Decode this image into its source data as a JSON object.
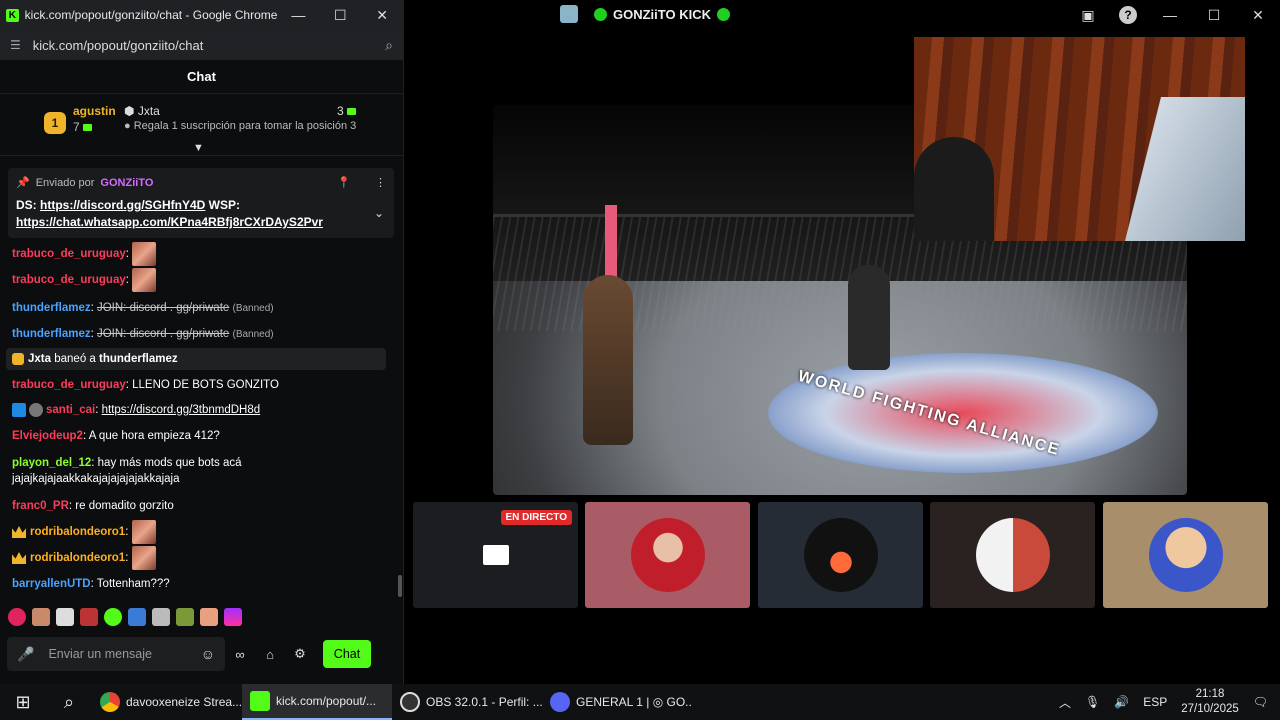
{
  "chrome": {
    "title": "kick.com/popout/gonziito/chat - Google Chrome",
    "url": "kick.com/popout/gonziito/chat",
    "logo": "K"
  },
  "chat": {
    "header": "Chat",
    "leaderboard": {
      "rank": "1",
      "user1": "agustin",
      "user1_count": "7",
      "user2": "Jxta",
      "user2_count": "3",
      "hint": "Regala 1 suscripción para tomar la posición 3"
    },
    "pinned": {
      "sent_by": "Enviado por",
      "owner": "GONZiiTO",
      "line1_prefix": "DS: ",
      "line1_link": "https://discord.gg/SGHfnY4D",
      "line1_suffix": " WSP:",
      "line2_link": "https://chat.whatsapp.com/KPna4RBfj8rCXrDAyS2Pvr"
    },
    "messages": {
      "m1_user": "trabuco_de_uruguay",
      "m2_user": "trabuco_de_uruguay",
      "m3_user": "thunderflamez",
      "m3_text": "JOIN: discord . gg/priwate",
      "banned": "(Banned)",
      "m4_user": "thunderflamez",
      "m4_text": "JOIN: discord . gg/priwate",
      "ban_mod": "Jxta",
      "ban_text": "baneó a",
      "ban_target": "thunderflamez",
      "m5_user": "trabuco_de_uruguay",
      "m5_text": "LLENO DE BOTS GONZITO",
      "m6_user": "santi_cai",
      "m6_link": "https://discord.gg/3tbnmdDH8d",
      "m7_user": "Elviejodeup2",
      "m7_text": "A que hora empieza 412?",
      "m8_user": "playon_del_12",
      "m8_text": "hay más mods que bots acá jajajkajajaakkakajajajajajakkajaja",
      "m9_user": "franc0_PR",
      "m9_text": "re domadito gorzito",
      "m10_user": "rodribalondeoro1",
      "m11_user": "rodribalondeoro1",
      "m12_user": "barryallenUTD",
      "m12_text": "Tottenham???"
    },
    "composer": {
      "placeholder": "Enviar un mensaje",
      "send_label": "Chat"
    }
  },
  "stream": {
    "title": "GONZiiTO KICK",
    "video_logo_text": "WORLD FIGHTING ALLIANCE",
    "live_badge": "EN DIRECTO"
  },
  "taskbar": {
    "item1": "davooxeneize Strea...",
    "item2": "kick.com/popout/...",
    "item3": "OBS 32.0.1 - Perfil: ...",
    "item4": "GENERAL 1 | ◎ GO...",
    "lang": "ESP",
    "time": "21:18",
    "date": "27/10/2025"
  },
  "colors": {
    "kick_green": "#53fc18",
    "owner_purple": "#d36cff",
    "live_red": "#e02a2a"
  }
}
